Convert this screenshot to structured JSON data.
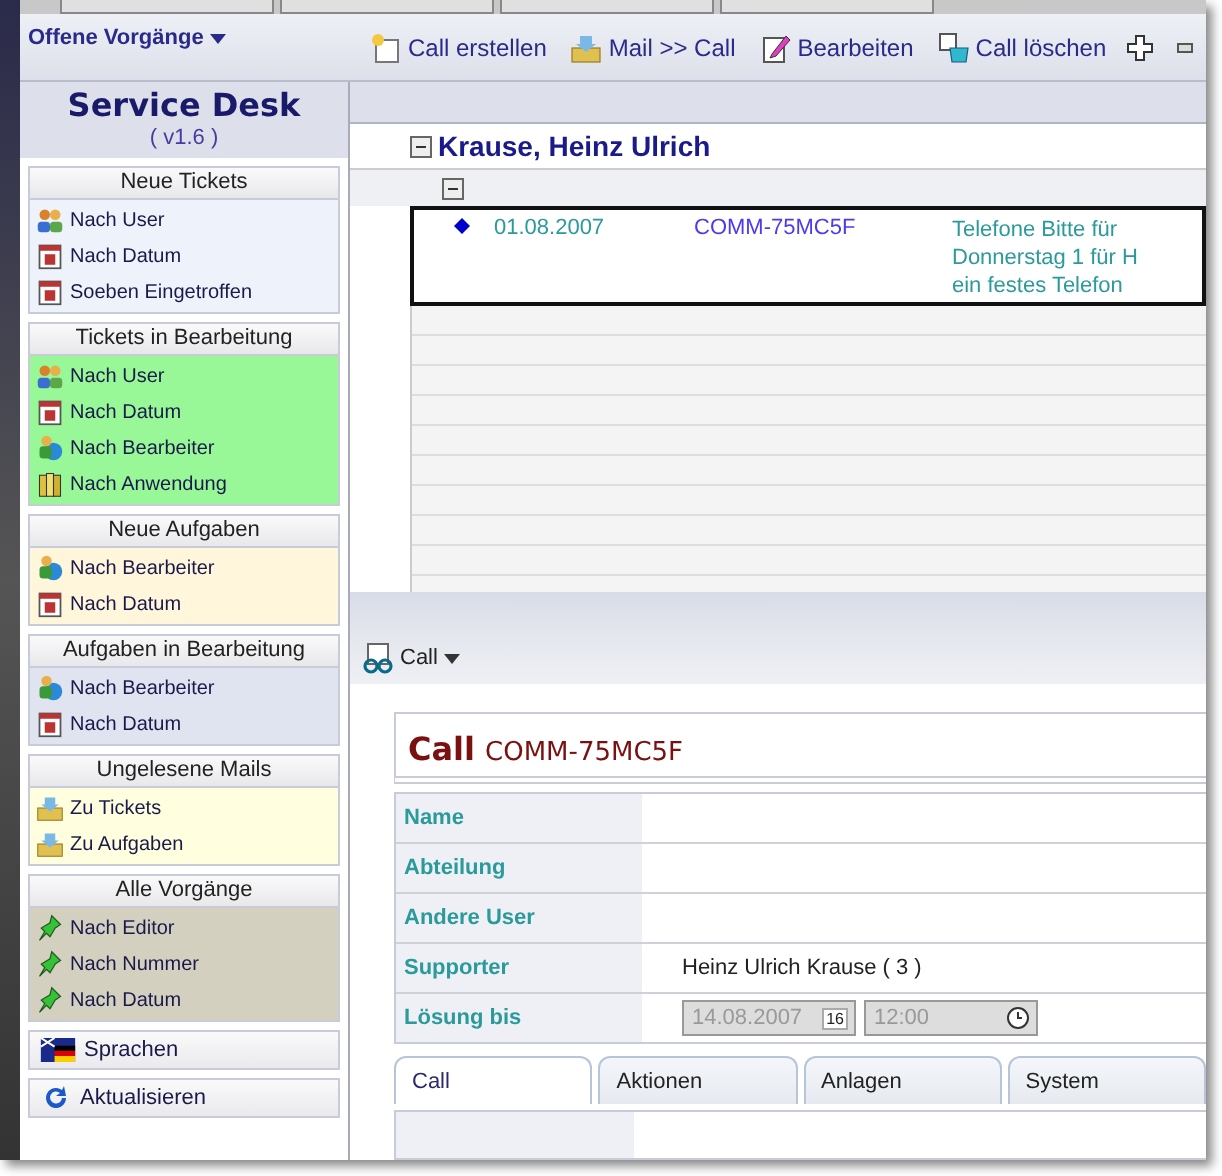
{
  "view_menu": {
    "label": "Offene Vorgänge"
  },
  "toolbar": [
    {
      "label": "Call erstellen",
      "kind": "new"
    },
    {
      "label": "Mail >> Call",
      "kind": "mail"
    },
    {
      "label": "Bearbeiten",
      "kind": "edit"
    },
    {
      "label": "Call löschen",
      "kind": "delete"
    }
  ],
  "app": {
    "title": "Service Desk",
    "version": "( v1.6 )"
  },
  "sidebar": {
    "sections": [
      {
        "title": "Neue Tickets",
        "color": "#eef2fb",
        "items": [
          {
            "label": "Nach User",
            "kind": "users"
          },
          {
            "label": "Nach Datum",
            "kind": "calendar"
          },
          {
            "label": "Soeben Eingetroffen",
            "kind": "calendar"
          }
        ]
      },
      {
        "title": "Tickets in Bearbeitung",
        "color": "#98f898",
        "items": [
          {
            "label": "Nach User",
            "kind": "users"
          },
          {
            "label": "Nach Datum",
            "kind": "calendar"
          },
          {
            "label": "Nach Bearbeiter",
            "kind": "person"
          },
          {
            "label": "Nach Anwendung",
            "kind": "books"
          }
        ]
      },
      {
        "title": "Neue Aufgaben",
        "color": "#fff6dc",
        "items": [
          {
            "label": "Nach Bearbeiter",
            "kind": "person"
          },
          {
            "label": "Nach Datum",
            "kind": "calendar"
          }
        ]
      },
      {
        "title": "Aufgaben in Bearbeitung",
        "color": "#dfe4f0",
        "items": [
          {
            "label": "Nach Bearbeiter",
            "kind": "person"
          },
          {
            "label": "Nach Datum",
            "kind": "calendar"
          }
        ]
      },
      {
        "title": "Ungelesene Mails",
        "color": "#ffffe0",
        "items": [
          {
            "label": "Zu Tickets",
            "kind": "mail"
          },
          {
            "label": "Zu Aufgaben",
            "kind": "mail"
          }
        ]
      },
      {
        "title": "Alle Vorgänge",
        "color": "#d4d0c0",
        "items": [
          {
            "label": "Nach Editor",
            "kind": "pin"
          },
          {
            "label": "Nach Nummer",
            "kind": "pin"
          },
          {
            "label": "Nach Datum",
            "kind": "pin"
          }
        ]
      }
    ],
    "actions": [
      {
        "label": "Sprachen",
        "kind": "flag"
      },
      {
        "label": "Aktualisieren",
        "kind": "refresh"
      }
    ]
  },
  "view": {
    "group": {
      "label": "Krause, Heinz Ulrich",
      "expanded": true
    },
    "rows": [
      {
        "date": "01.08.2007",
        "number": "COMM-75MC5F",
        "message": [
          "Telefone  Bitte für",
          "Donnerstag 1 für H",
          "ein festes Telefon"
        ],
        "selected": true
      }
    ]
  },
  "detail": {
    "menu": "Call",
    "heading": {
      "kind": "Call",
      "number": "COMM-75MC5F"
    },
    "fields": [
      {
        "label": "Name"
      },
      {
        "label": "Abteilung"
      },
      {
        "label": "Andere User"
      },
      {
        "label": "Supporter",
        "value": "Heinz Ulrich Krause ( 3 )"
      },
      {
        "label": "Lösung bis",
        "date": "14.08.2007",
        "date_button": "16",
        "time": "12:00",
        "disabled": true
      }
    ],
    "tabs": [
      {
        "label": "Call",
        "selected": true
      },
      {
        "label": "Aktionen",
        "selected": false
      },
      {
        "label": "Anlagen",
        "selected": false
      },
      {
        "label": "System",
        "selected": false
      }
    ]
  }
}
